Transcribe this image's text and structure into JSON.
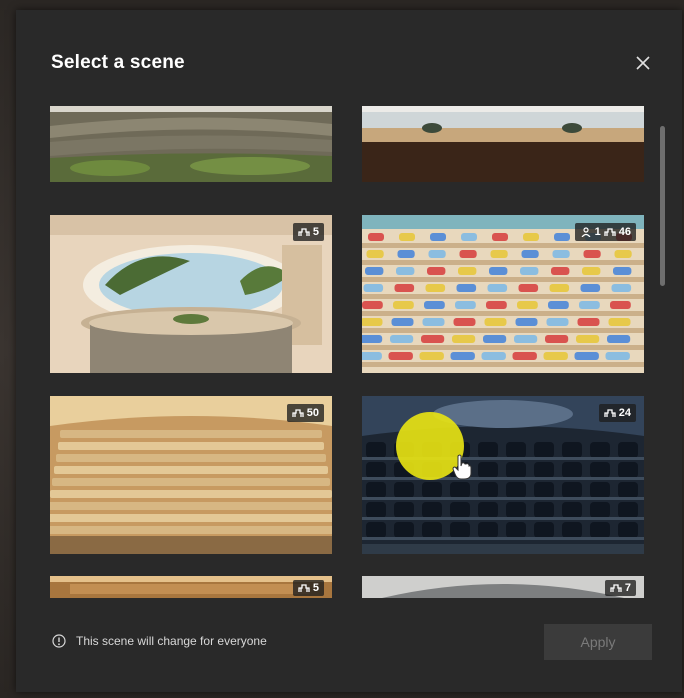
{
  "dialog": {
    "title": "Select a scene",
    "footer_note": "This scene will change for everyone",
    "apply_label": "Apply"
  },
  "scenes": [
    {
      "id": "garden",
      "badge_seats": ""
    },
    {
      "id": "conference",
      "badge_seats": ""
    },
    {
      "id": "lounge",
      "badge_seats": "5"
    },
    {
      "id": "classroom",
      "badge_people": "1",
      "badge_seats": "46"
    },
    {
      "id": "auditorium",
      "badge_seats": "50"
    },
    {
      "id": "briefing",
      "badge_seats": "24"
    },
    {
      "id": "hall",
      "badge_seats": "5"
    },
    {
      "id": "dome",
      "badge_seats": "7"
    }
  ],
  "colors": {
    "dialog_bg": "#292929",
    "highlight": "#e6e214"
  },
  "icons": [
    "close-icon",
    "seat-icon",
    "person-icon",
    "info-icon",
    "hand-cursor-icon"
  ]
}
